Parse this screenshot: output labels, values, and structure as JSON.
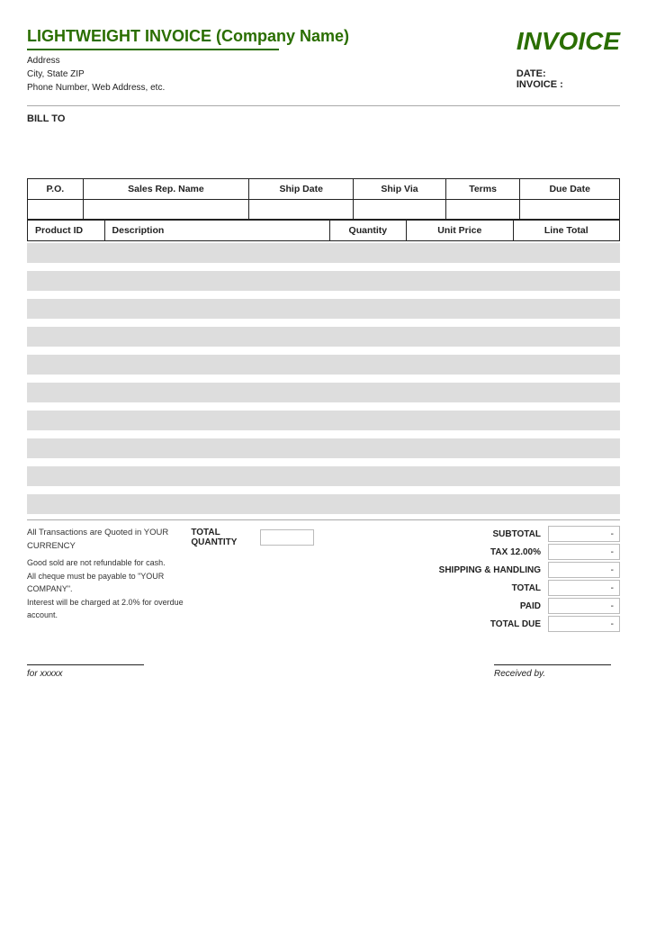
{
  "header": {
    "company_name": "LIGHTWEIGHT INVOICE (Company Name)",
    "invoice_word": "INVOICE",
    "address_line1": "Address",
    "address_line2": "City, State ZIP",
    "address_line3": "Phone Number, Web Address, etc.",
    "date_label": "DATE:",
    "invoice_label": "INVOICE :"
  },
  "bill_to": {
    "label": "BILL TO"
  },
  "order_table": {
    "headers": [
      "P.O.",
      "Sales Rep. Name",
      "Ship Date",
      "Ship Via",
      "Terms",
      "Due Date"
    ]
  },
  "items_table": {
    "headers": [
      "Product ID",
      "Description",
      "Quantity",
      "Unit Price",
      "Line Total"
    ],
    "row_count": 10
  },
  "footer": {
    "currency_note": "All Transactions are Quoted in YOUR CURRENCY",
    "notes": [
      "Good sold are not refundable for cash.",
      "All cheque must be payable to \"YOUR COMPANY\".",
      "Interest will be charged at 2.0% for overdue account."
    ],
    "total_quantity_label": "TOTAL QUANTITY",
    "subtotal_label": "SUBTOTAL",
    "tax_label": "TAX",
    "tax_rate": "12.00%",
    "shipping_label": "SHIPPING & HANDLING",
    "total_label": "TOTAL",
    "paid_label": "PAID",
    "total_due_label": "TOTAL DUE",
    "dash": "-"
  },
  "signatures": {
    "for_label": "for xxxxx",
    "received_label": "Received by."
  }
}
